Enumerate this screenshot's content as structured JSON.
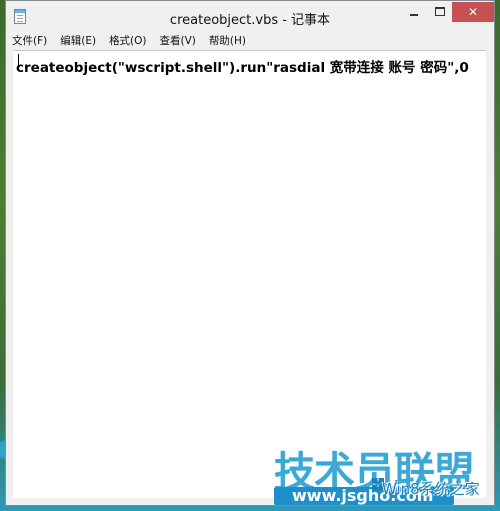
{
  "window": {
    "title": "createobject.vbs - 记事本",
    "controls": {
      "minimize": "minimize",
      "maximize": "maximize",
      "close": "✕"
    }
  },
  "menu": {
    "items": [
      {
        "label": "文件(F)"
      },
      {
        "label": "编辑(E)"
      },
      {
        "label": "格式(O)"
      },
      {
        "label": "查看(V)"
      },
      {
        "label": "帮助(H)"
      }
    ]
  },
  "editor": {
    "content": "createobject(\"wscript.shell\").run\"rasdial 宽带连接 账号 密码\",0"
  },
  "watermark": {
    "main": "技术员联盟",
    "url": "www.jsgho.com",
    "sub": "Win8系统之家"
  },
  "colors": {
    "titlebar": "#f0f0f0",
    "close_button": "#c75050",
    "editor_bg": "#ffffff",
    "watermark_blue": "#3ba8d6"
  }
}
